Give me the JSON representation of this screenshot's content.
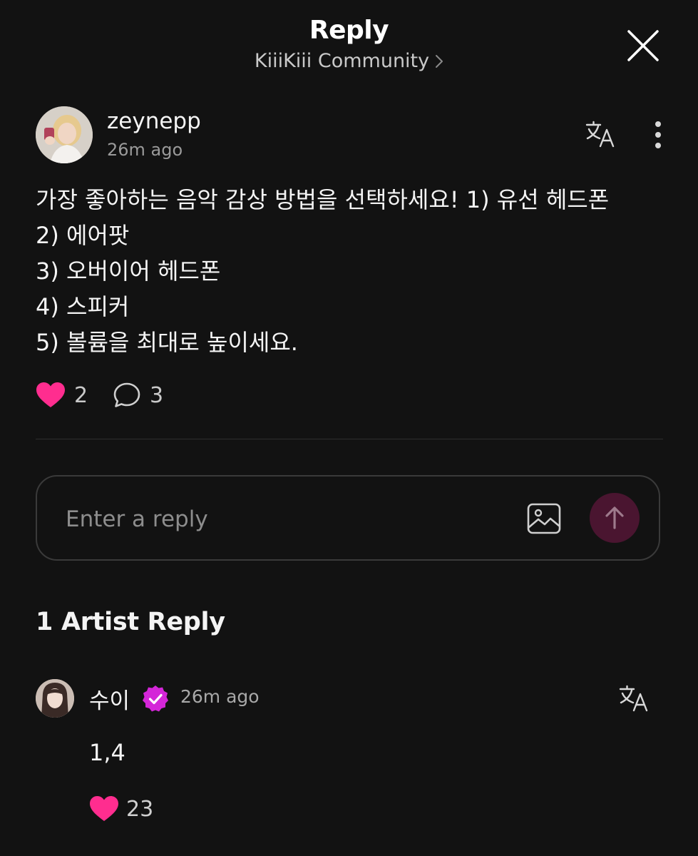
{
  "header": {
    "title": "Reply",
    "community": "KiiiKiii Community"
  },
  "post": {
    "username": "zeynepp",
    "time": "26m ago",
    "body": "가장 좋아하는 음악 감상 방법을 선택하세요! 1) 유선 헤드폰\n2) 에어팟\n3) 오버이어 헤드폰\n4) 스피커\n5) 볼륨을 최대로 높이세요.",
    "likes": "2",
    "comments": "3"
  },
  "reply_input": {
    "placeholder": "Enter a reply"
  },
  "artist_replies": {
    "title": "1 Artist Reply",
    "items": [
      {
        "name": "수이",
        "time": "26m ago",
        "body": "1,4",
        "likes": "23"
      }
    ]
  },
  "icons": {
    "close": "close-icon",
    "chevron": "chevron-right-icon",
    "translate": "translate-icon",
    "more": "more-vertical-icon",
    "like": "heart-icon",
    "comment": "comment-icon",
    "image": "image-icon",
    "send": "arrow-up-icon",
    "verified": "verified-badge-icon"
  },
  "colors": {
    "background": "#121212",
    "heart": "#ff2d8f",
    "send_button": "#4a1530",
    "verified": "#d426d8"
  }
}
